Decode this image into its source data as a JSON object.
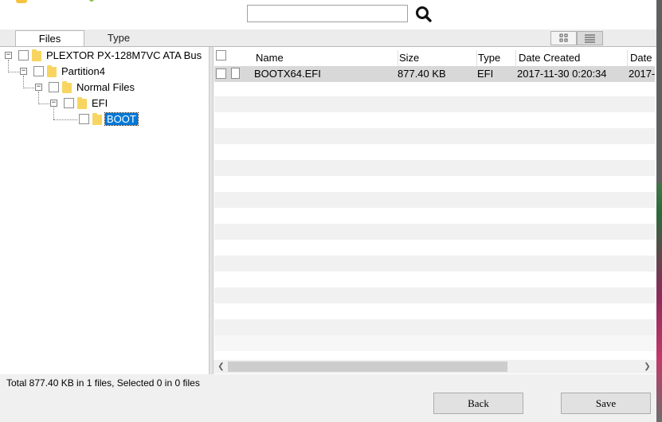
{
  "search": {
    "value": "",
    "placeholder": ""
  },
  "tabs": [
    {
      "label": "Files",
      "active": true
    },
    {
      "label": "Type",
      "active": false
    }
  ],
  "view_modes": {
    "grid_icon": "grid-view-icon",
    "list_icon": "list-view-icon",
    "active": "list"
  },
  "tree": [
    {
      "label": "PLEXTOR PX-128M7VC  ATA Bus",
      "level": 0,
      "expanded": true
    },
    {
      "label": "Partition4",
      "level": 1,
      "expanded": true
    },
    {
      "label": "Normal Files",
      "level": 2,
      "expanded": true
    },
    {
      "label": "EFI",
      "level": 3,
      "expanded": true
    },
    {
      "label": "BOOT",
      "level": 4,
      "selected": true
    }
  ],
  "file_list": {
    "columns": [
      "Name",
      "Size",
      "Type",
      "Date Created",
      "Date"
    ],
    "rows": [
      {
        "name": "BOOTX64.EFI",
        "size": "877.40 KB",
        "type": "EFI",
        "date_created": "2017-11-30 0:20:34",
        "date": "2017-"
      }
    ]
  },
  "status": {
    "text": "Total 877.40 KB in 1 files,  Selected 0 in 0 files"
  },
  "buttons": {
    "back": "Back",
    "save": "Save"
  },
  "colors": {
    "selection": "#0078d7",
    "folder": "#f7d560",
    "row_band": "#f1f1f1",
    "row_selected": "#d8d8d8"
  }
}
